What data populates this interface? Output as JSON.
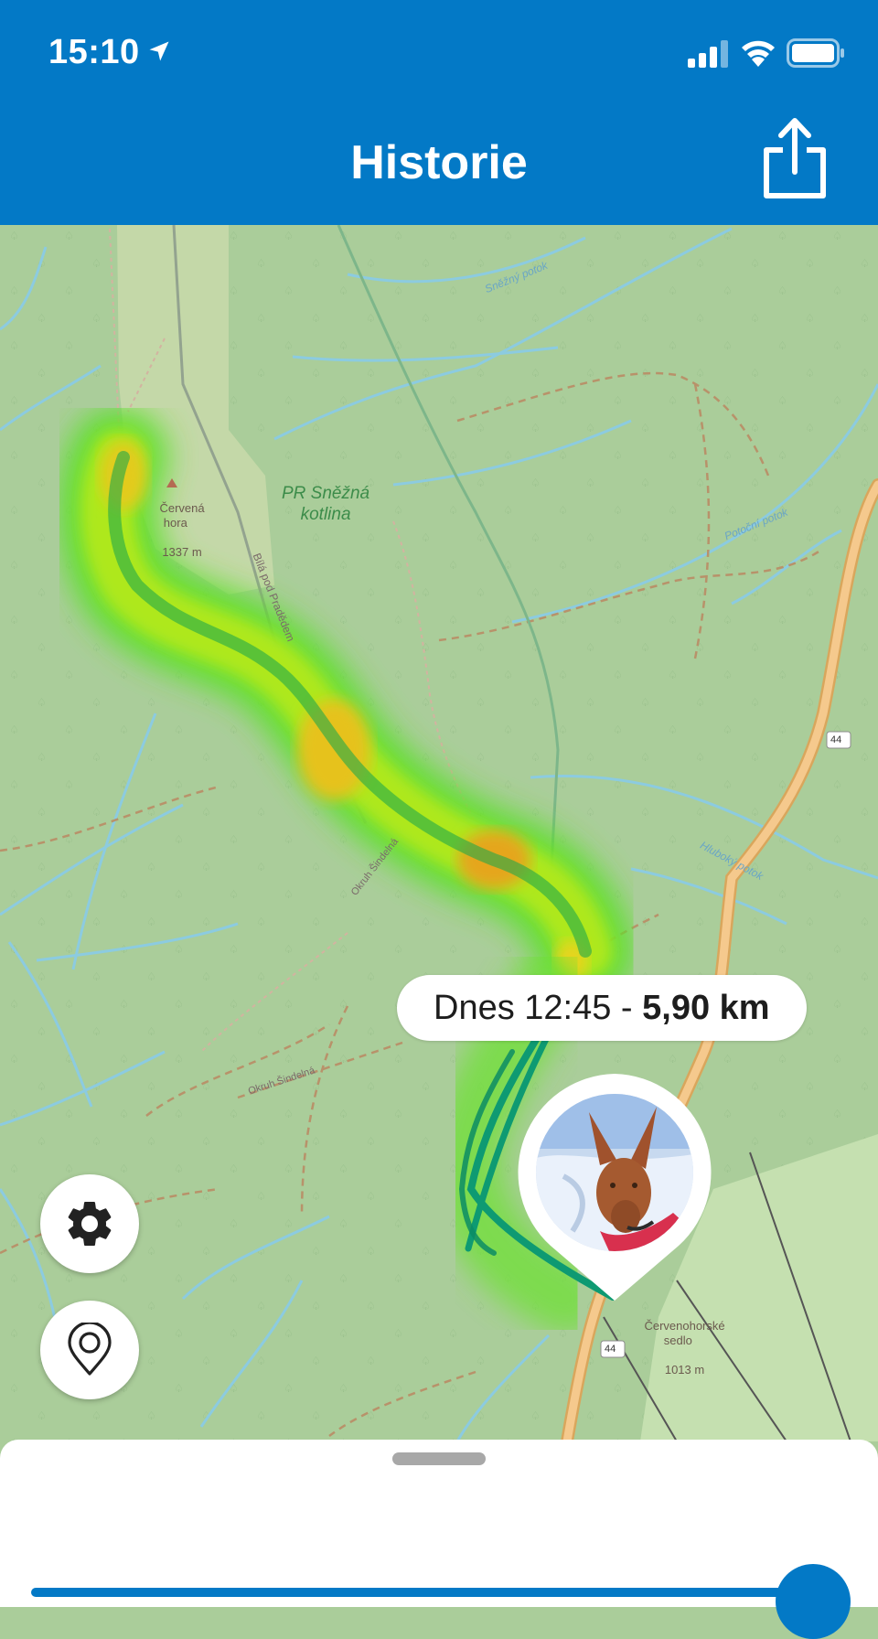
{
  "status_bar": {
    "time": "15:10"
  },
  "header": {
    "title": "Historie",
    "share_icon": "share-icon"
  },
  "map": {
    "place_labels": {
      "peak_name": "Červená\nhora",
      "peak_elev": "1337 m",
      "reserve": "PR Sněžná\nkotlina",
      "stream1": "Sněžný potok",
      "stream2": "Potoční potok",
      "stream3": "Hluboký potok",
      "trail1": "Bílá pod Pradědem",
      "trail2": "Okruh Šindelná",
      "trail3": "Okruh Šindelná",
      "saddle": "Červenohorské\nsedlo",
      "saddle_elev": "1013 m",
      "road1": "44",
      "road2": "44"
    }
  },
  "track_label": {
    "prefix": "Dnes 12:45 - ",
    "distance": "5,90 km"
  },
  "controls": {
    "settings_icon": "gear-icon",
    "location_icon": "location-pin-icon"
  },
  "timeline": {
    "slider_value": 1.0
  },
  "colors": {
    "primary": "#0379c6",
    "map_bg": "#aacd9a",
    "track": "#0a9a6a"
  }
}
